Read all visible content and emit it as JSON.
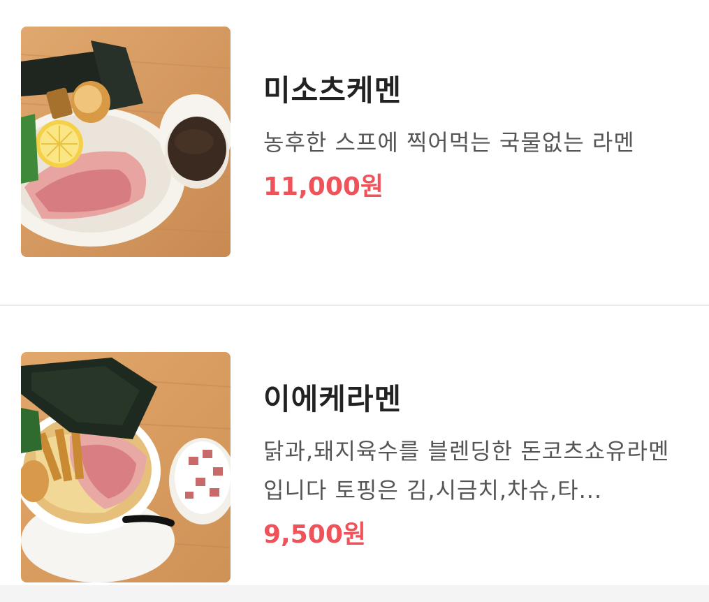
{
  "menu": {
    "items": [
      {
        "name": "미소츠케멘",
        "description": "농후한 스프에 찍어먹는 국물없는 라멘",
        "price": "11,000원",
        "image_alt": "미소츠케멘"
      },
      {
        "name": "이에케라멘",
        "description": "닭과,돼지육수를 블렌딩한 돈코츠쇼유라멘 입니다 토핑은 김,시금치,차슈,타...",
        "price": "9,500원",
        "image_alt": "이에케라멘"
      }
    ]
  },
  "colors": {
    "price": "#f0525a",
    "name": "#222222",
    "description": "#555555",
    "divider": "#ececec"
  }
}
